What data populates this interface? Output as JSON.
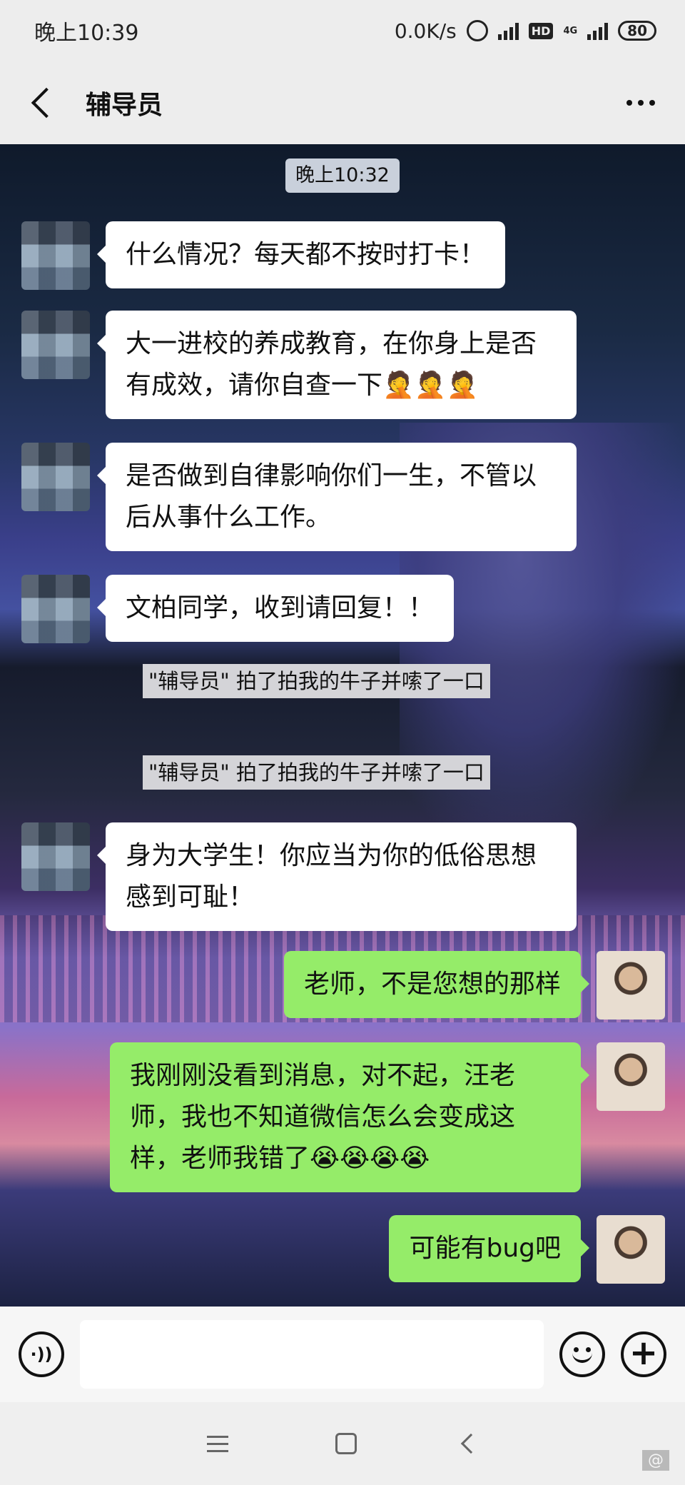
{
  "status_bar": {
    "time": "晚上10:39",
    "network_speed": "0.0K/s",
    "hd_label": "HD",
    "network_type": "4G",
    "battery": "80"
  },
  "header": {
    "title": "辅导员"
  },
  "chat": {
    "timestamp": "晚上10:32",
    "messages": [
      {
        "side": "left",
        "text": "什么情况？每天都不按时打卡！"
      },
      {
        "side": "left",
        "text": "大一进校的养成教育，在你身上是否有成效，请你自查一下🤦🤦🤦"
      },
      {
        "side": "left",
        "text": "是否做到自律影响你们一生，不管以后从事什么工作。"
      },
      {
        "side": "left",
        "text": "文柏同学，收到请回复！！"
      },
      {
        "side": "left",
        "text": "身为大学生！你应当为你的低俗思想感到可耻！"
      },
      {
        "side": "right",
        "text": "老师，不是您想的那样"
      },
      {
        "side": "right",
        "text": "我刚刚没看到消息，对不起，汪老师，我也不知道微信怎么会变成这样，老师我错了😭😭😭😭"
      },
      {
        "side": "right",
        "text": "可能有bug吧"
      }
    ],
    "system_notices": [
      "\"辅导员\" 拍了拍我的牛子并嗦了一口",
      "\"辅导员\" 拍了拍我的牛子并嗦了一口"
    ]
  },
  "input_bar": {
    "value": "",
    "voice_icon": "voice-icon",
    "emoji_icon": "emoji-icon",
    "plus_icon": "plus-icon"
  },
  "watermark": "@"
}
